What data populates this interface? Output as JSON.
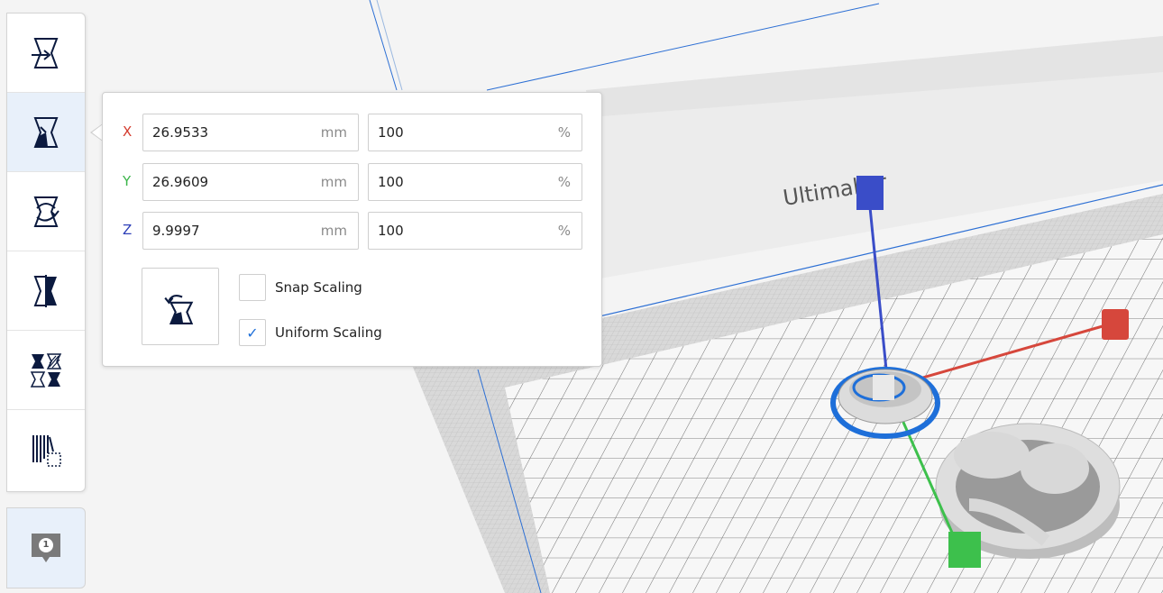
{
  "scene": {
    "brand_text": "Ultimaker"
  },
  "toolbar": {
    "tools": [
      {
        "name": "move-tool",
        "icon": "move-icon"
      },
      {
        "name": "scale-tool",
        "icon": "scale-icon",
        "active": true
      },
      {
        "name": "rotate-tool",
        "icon": "rotate-icon"
      },
      {
        "name": "mirror-tool",
        "icon": "mirror-icon"
      },
      {
        "name": "per-model-settings-tool",
        "icon": "per-model-settings-icon"
      },
      {
        "name": "support-blocker-tool",
        "icon": "support-blocker-icon"
      }
    ],
    "message_count": "1"
  },
  "scale_panel": {
    "x": {
      "label": "X",
      "mm": "26.9533",
      "mm_unit": "mm",
      "percent": "100",
      "percent_unit": "%",
      "color": "#d43b2e"
    },
    "y": {
      "label": "Y",
      "mm": "26.9609",
      "mm_unit": "mm",
      "percent": "100",
      "percent_unit": "%",
      "color": "#3bb54a"
    },
    "z": {
      "label": "Z",
      "mm": "9.9997",
      "mm_unit": "mm",
      "percent": "100",
      "percent_unit": "%",
      "color": "#2d3fb8"
    },
    "snap_scaling": {
      "label": "Snap Scaling",
      "checked": false
    },
    "uniform_scaling": {
      "label": "Uniform Scaling",
      "checked": true,
      "check_glyph": "✓"
    }
  },
  "colors": {
    "accent": "#1e6fd9",
    "tool_icon": "#0b1a3f",
    "active_bg": "#e8f0fa"
  }
}
